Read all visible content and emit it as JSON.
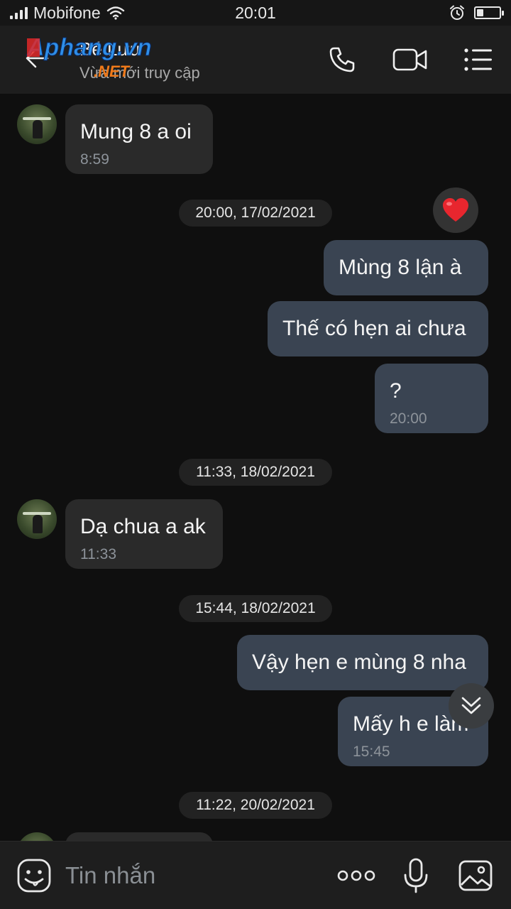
{
  "status_bar": {
    "carrier": "Mobifone",
    "time": "20:01",
    "battery_level": 0.3
  },
  "header": {
    "contact_name": "Bé Lưu",
    "subtitle": "Vừa mới truy cập",
    "watermark_text": "Aphang.vn",
    "watermark_sub": ".NET"
  },
  "messages": {
    "m1_text": "Mung 8 a oi",
    "m1_time": "8:59",
    "d1": "20:00, 17/02/2021",
    "reaction": "heart",
    "m2_text": "Mùng 8 lận à",
    "m3_text": "Thế có hẹn ai chưa",
    "m4_text": "?",
    "m4_time": "20:00",
    "d2": "11:33, 18/02/2021",
    "m5_text": "Dạ chua a ak",
    "m5_time": "11:33",
    "d3": "15:44, 18/02/2021",
    "m6_text": "Vậy hẹn e mùng 8 nha",
    "m7_text": "Mấy h e làm",
    "m7_time": "15:45",
    "d4": "11:22, 20/02/2021"
  },
  "input": {
    "placeholder": "Tin nhắn"
  },
  "colors": {
    "incoming_bubble": "#2a2a2a",
    "outgoing_bubble": "#3a4452",
    "background": "#0f0f0f",
    "heart": "#e8262e"
  }
}
